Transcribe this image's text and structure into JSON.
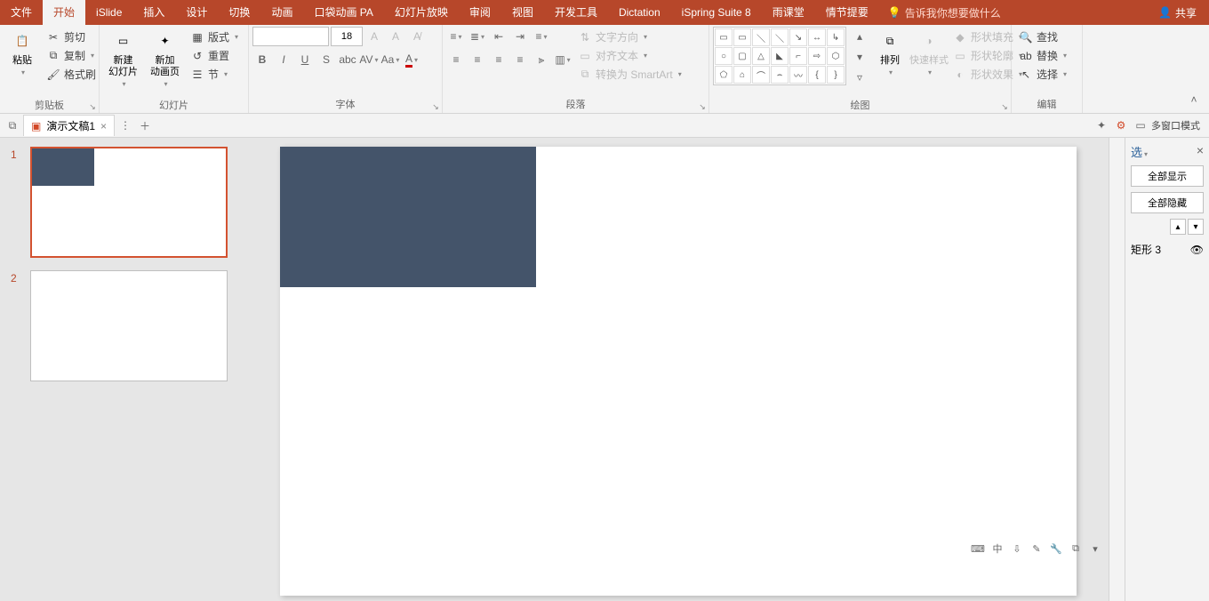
{
  "tabs": {
    "file": "文件",
    "home": "开始",
    "islide": "iSlide",
    "insert": "插入",
    "design": "设计",
    "transition": "切换",
    "animation": "动画",
    "pa": "口袋动画 PA",
    "slideshow": "幻灯片放映",
    "review": "审阅",
    "view": "视图",
    "developer": "开发工具",
    "dictation": "Dictation",
    "ispring": "iSpring Suite 8",
    "rain": "雨课堂",
    "plot": "情节提要"
  },
  "search_prompt": "告诉我你想要做什么",
  "share": "共享",
  "groups": {
    "clipboard": "剪贴板",
    "slides": "幻灯片",
    "font": "字体",
    "paragraph": "段落",
    "drawing": "绘图",
    "editing": "编辑"
  },
  "clipboard": {
    "paste": "粘贴",
    "cut": "剪切",
    "copy": "复制",
    "format": "格式刷"
  },
  "slides": {
    "new": "新建\n幻灯片",
    "addanim": "新加\n动画页",
    "layout": "版式",
    "reset": "重置",
    "section": "节"
  },
  "font": {
    "size": "18"
  },
  "paragraph": {
    "textdir": "文字方向",
    "align": "对齐文本",
    "smartart": "转换为 SmartArt"
  },
  "drawing": {
    "arrange": "排列",
    "quick": "快速样式",
    "fill": "形状填充",
    "outline": "形状轮廓",
    "effects": "形状效果"
  },
  "editing": {
    "find": "查找",
    "replace": "替换",
    "select": "选择"
  },
  "doc_tab": "演示文稿1",
  "multiwindow": "多窗口模式",
  "selection": {
    "title": "选",
    "showall": "全部显示",
    "hideall": "全部隐藏",
    "item": "矩形 3"
  },
  "thumbs": {
    "n1": "1",
    "n2": "2"
  }
}
